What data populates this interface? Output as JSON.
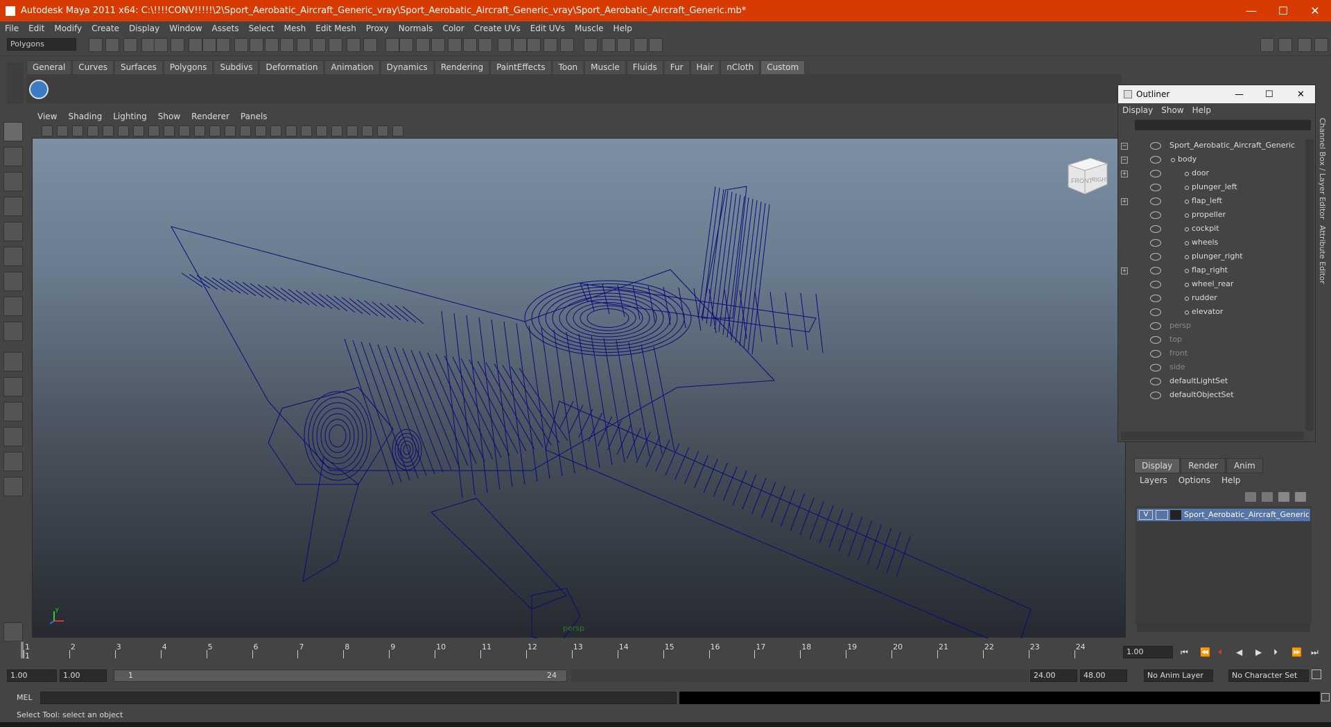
{
  "window": {
    "title": "Autodesk Maya 2011 x64: C:\\!!!!CONV!!!!!\\2\\Sport_Aerobatic_Aircraft_Generic_vray\\Sport_Aerobatic_Aircraft_Generic_vray\\Sport_Aerobatic_Aircraft_Generic.mb*",
    "controls": {
      "minimize": "—",
      "maximize": "☐",
      "close": "✕"
    }
  },
  "menubar": [
    "File",
    "Edit",
    "Modify",
    "Create",
    "Display",
    "Window",
    "Assets",
    "Select",
    "Mesh",
    "Edit Mesh",
    "Proxy",
    "Normals",
    "Color",
    "Create UVs",
    "Edit UVs",
    "Muscle",
    "Help"
  ],
  "mode_select": "Polygons",
  "shelf_tabs": [
    "General",
    "Curves",
    "Surfaces",
    "Polygons",
    "Subdivs",
    "Deformation",
    "Animation",
    "Dynamics",
    "Rendering",
    "PaintEffects",
    "Toon",
    "Muscle",
    "Fluids",
    "Fur",
    "Hair",
    "nCloth",
    "Custom"
  ],
  "active_shelf_tab": "Custom",
  "viewport": {
    "menu": [
      "View",
      "Shading",
      "Lighting",
      "Show",
      "Renderer",
      "Panels"
    ],
    "camera_label": "persp",
    "viewcube": {
      "front": "FRONT",
      "right": "RIGHT"
    },
    "axis": {
      "x": "x",
      "y": "y"
    },
    "wire_color": "#0a0a7a"
  },
  "outliner": {
    "title": "Outliner",
    "menu": [
      "Display",
      "Show",
      "Help"
    ],
    "items": [
      {
        "label": "Sport_Aerobatic_Aircraft_Generic",
        "level": 0,
        "dim": false,
        "expander": "−"
      },
      {
        "label": "body",
        "level": 1,
        "dim": false,
        "expander": "−"
      },
      {
        "label": "door",
        "level": 2,
        "dim": false,
        "expander": "+"
      },
      {
        "label": "plunger_left",
        "level": 2,
        "dim": false,
        "expander": ""
      },
      {
        "label": "flap_left",
        "level": 2,
        "dim": false,
        "expander": "+"
      },
      {
        "label": "propeller",
        "level": 2,
        "dim": false,
        "expander": ""
      },
      {
        "label": "cockpit",
        "level": 2,
        "dim": false,
        "expander": ""
      },
      {
        "label": "wheels",
        "level": 2,
        "dim": false,
        "expander": ""
      },
      {
        "label": "plunger_right",
        "level": 2,
        "dim": false,
        "expander": ""
      },
      {
        "label": "flap_right",
        "level": 2,
        "dim": false,
        "expander": "+"
      },
      {
        "label": "wheel_rear",
        "level": 2,
        "dim": false,
        "expander": ""
      },
      {
        "label": "rudder",
        "level": 2,
        "dim": false,
        "expander": ""
      },
      {
        "label": "elevator",
        "level": 2,
        "dim": false,
        "expander": ""
      },
      {
        "label": "persp",
        "level": 0,
        "dim": true,
        "expander": ""
      },
      {
        "label": "top",
        "level": 0,
        "dim": true,
        "expander": ""
      },
      {
        "label": "front",
        "level": 0,
        "dim": true,
        "expander": ""
      },
      {
        "label": "side",
        "level": 0,
        "dim": true,
        "expander": ""
      },
      {
        "label": "defaultLightSet",
        "level": 0,
        "dim": false,
        "expander": ""
      },
      {
        "label": "defaultObjectSet",
        "level": 0,
        "dim": false,
        "expander": ""
      }
    ]
  },
  "side_tabs": {
    "channel_box": "Channel Box / Layer Editor",
    "attribute_editor": "Attribute Editor"
  },
  "layer_editor": {
    "tabs": [
      "Display",
      "Render",
      "Anim"
    ],
    "active_tab": "Display",
    "menu": [
      "Layers",
      "Options",
      "Help"
    ],
    "layer": {
      "visible": "V",
      "name": "Sport_Aerobatic_Aircraft_Generic_layer"
    }
  },
  "time_slider": {
    "ticks": [
      "1",
      "2",
      "3",
      "4",
      "5",
      "6",
      "7",
      "8",
      "9",
      "10",
      "11",
      "12",
      "13",
      "14",
      "15",
      "16",
      "17",
      "18",
      "19",
      "20",
      "21",
      "22",
      "23",
      "24"
    ],
    "current_frame_marker": "1",
    "current_frame": "1.00"
  },
  "range_slider": {
    "start_time": "1.00",
    "playback_start": "1.00",
    "range_start_label": "1",
    "range_end_label": "24",
    "playback_end": "24.00",
    "end_time": "48.00",
    "anim_layer": "No Anim Layer",
    "character_set": "No Character Set"
  },
  "command_line": {
    "label": "MEL"
  },
  "help_line": "Select Tool: select an object"
}
